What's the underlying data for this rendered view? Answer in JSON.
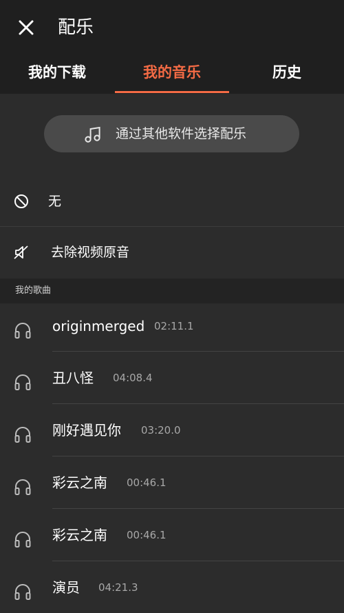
{
  "header": {
    "title": "配乐",
    "close_icon": "close-icon"
  },
  "tabs": [
    {
      "label": "我的下载",
      "active": false
    },
    {
      "label": "我的音乐",
      "active": true
    },
    {
      "label": "历史",
      "active": false
    }
  ],
  "accent_color": "#f46b45",
  "pick_button": {
    "label": "通过其他软件选择配乐",
    "icon": "music-note-icon"
  },
  "options": [
    {
      "label": "无",
      "icon": "block-icon"
    },
    {
      "label": "去除视频原音",
      "icon": "mute-icon"
    }
  ],
  "section": {
    "label": "我的歌曲"
  },
  "songs": [
    {
      "name": "originmerged",
      "duration": "02:11.1",
      "icon": "headphones-icon"
    },
    {
      "name": "丑八怪",
      "duration": "04:08.4",
      "icon": "headphones-icon"
    },
    {
      "name": "刚好遇见你",
      "duration": "03:20.0",
      "icon": "headphones-icon"
    },
    {
      "name": "彩云之南",
      "duration": "00:46.1",
      "icon": "headphones-icon"
    },
    {
      "name": "彩云之南",
      "duration": "00:46.1",
      "icon": "headphones-icon"
    },
    {
      "name": "演员",
      "duration": "04:21.3",
      "icon": "headphones-icon"
    }
  ]
}
